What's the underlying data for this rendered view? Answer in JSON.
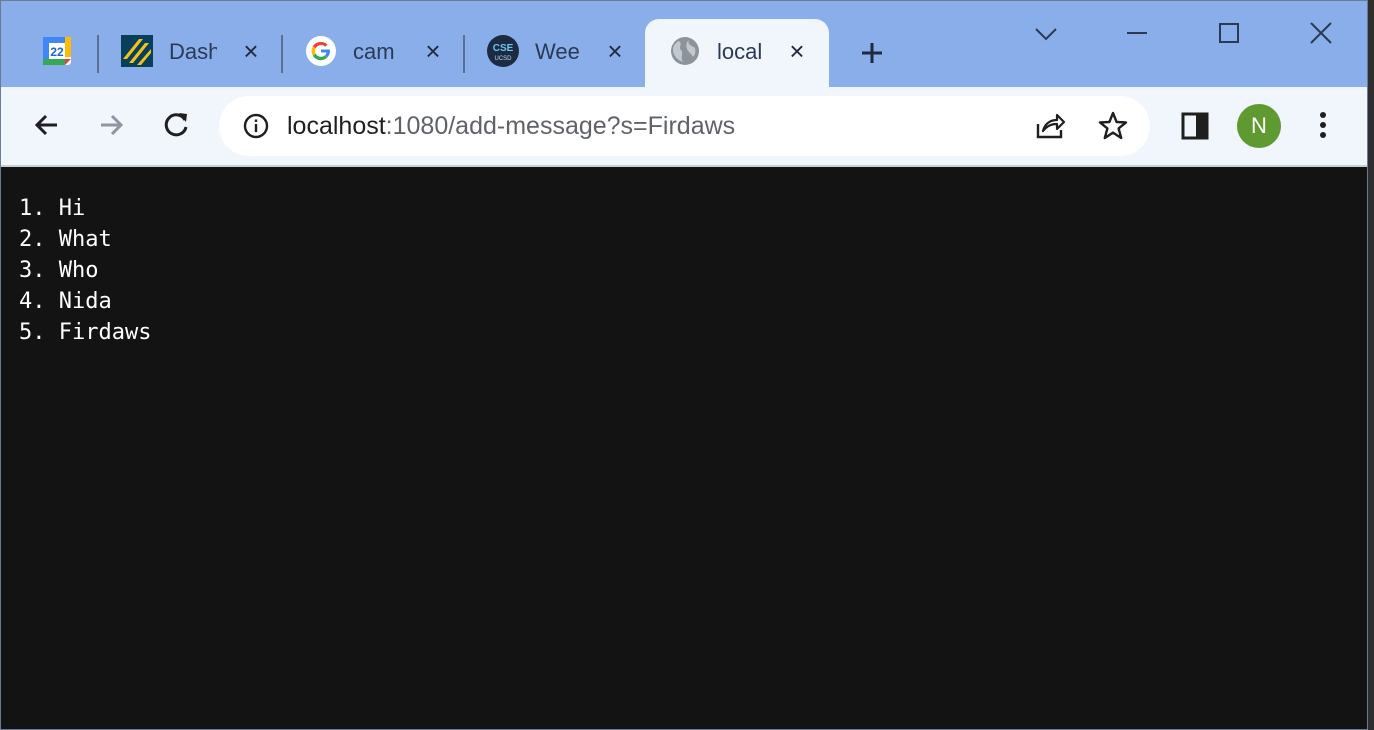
{
  "tabs": [
    {
      "title": "",
      "favicon": "google-calendar-icon",
      "favicon_text": "22"
    },
    {
      "title": "Dash",
      "favicon": "canvas-dashboard-icon"
    },
    {
      "title": "cam",
      "favicon": "google-g-icon"
    },
    {
      "title": "Wee",
      "favicon": "cse-ucsd-icon",
      "favicon_text_top": "CSE",
      "favicon_text_bottom": "UCSD"
    },
    {
      "title": "local",
      "favicon": "globe-icon",
      "active": true
    }
  ],
  "address_bar": {
    "host": "localhost",
    "path": ":1080/add-message?s=Firdaws"
  },
  "profile": {
    "initial": "N",
    "color": "#5f9a30"
  },
  "messages": [
    "1. Hi",
    "2. What",
    "3. Who",
    "4. Nida",
    "5. Firdaws"
  ],
  "colors": {
    "tab_strip": "#8aaee9",
    "toolbar": "#f1f5fc",
    "page_background": "#131313"
  }
}
